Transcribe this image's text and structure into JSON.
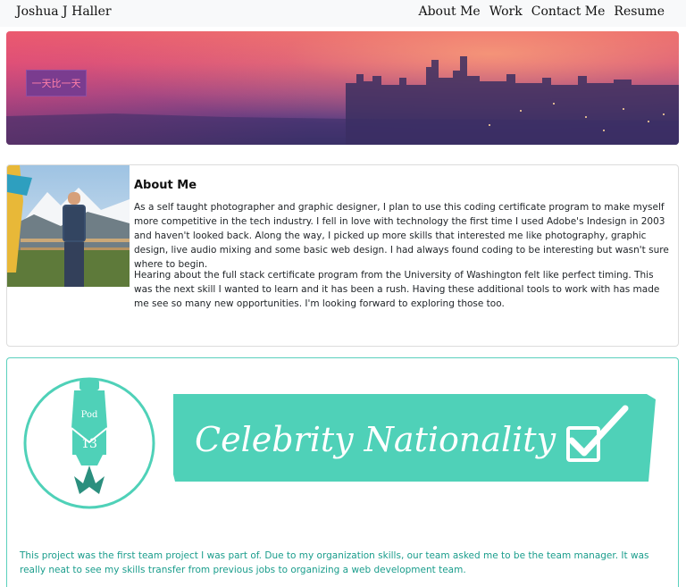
{
  "navbar": {
    "brand": "Joshua J Haller",
    "links": [
      {
        "label": "About Me"
      },
      {
        "label": "Work"
      },
      {
        "label": "Contact Me"
      },
      {
        "label": "Resume"
      }
    ]
  },
  "hero": {
    "badge_text": "一天比一天"
  },
  "about": {
    "title": "About Me",
    "paragraphs": [
      "As a self taught photographer and graphic designer, I plan to use this coding certificate program to make myself more competitive in the tech industry. I fell in love with technology the first time I used Adobe's Indesign in 2003 and haven't looked back. Along the way, I picked up more skills that interested me like photography, graphic design, live audio mixing and some basic web design. I had always found coding to be interesting but wasn't sure where to begin.",
      "Hearing about the full stack certificate program from the University of Washington felt like perfect timing. This was the next skill I wanted to learn and it has been a rush. Having these additional tools to work with has made me see so many new opportunities. I'm looking forward to exploring those too."
    ]
  },
  "project": {
    "logo": {
      "pod_label": "Pod",
      "pod_number": "13"
    },
    "banner_title": "Celebrity Nationality",
    "description": "This project was the first team project I was part of. Due to my organization skills, our team asked me to be the team manager. It was really neat to see my skills transfer from previous jobs to organizing a web development team."
  },
  "colors": {
    "accent_teal": "#4fd1b8",
    "project_text": "#1a9d8c",
    "badge_bg": "#7a3c8f",
    "badge_text": "#ff7fa8"
  }
}
